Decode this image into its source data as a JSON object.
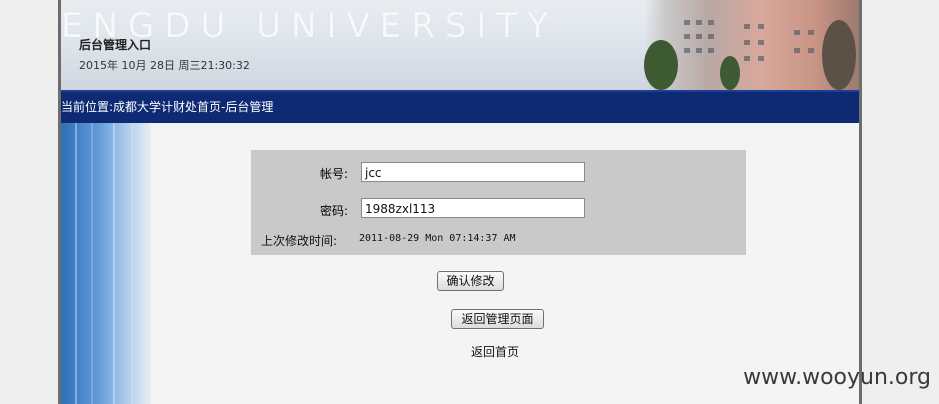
{
  "header": {
    "ghost_text": "ENGDU UNIVERSITY",
    "title": "后台管理入口",
    "datetime": "2015年 10月 28日 周三21:30:32"
  },
  "navbar": {
    "breadcrumb": "当前位置:成都大学计财处首页-后台管理"
  },
  "form": {
    "account_label": "帐号:",
    "account_value": "jcc",
    "password_label": "密码:",
    "password_value": "1988zxl113",
    "last_modified_label": "上次修改时间:",
    "last_modified_value": "2011-08-29 Mon 07:14:37 AM"
  },
  "actions": {
    "confirm_label": "确认修改",
    "back_admin_label": "返回管理页面",
    "back_home_label": "返回首页"
  },
  "watermark": "www.wooyun.org"
}
